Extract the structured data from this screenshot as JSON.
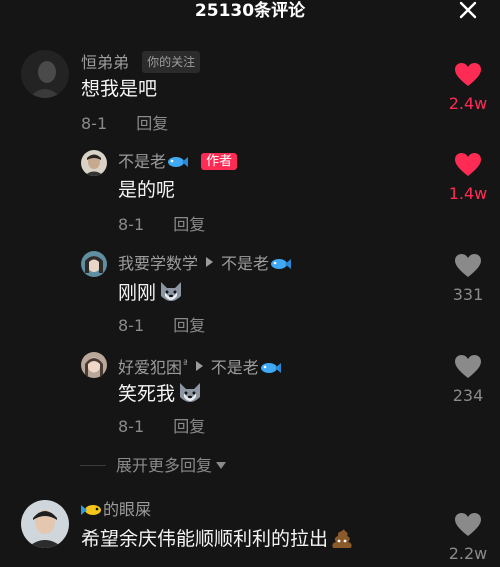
{
  "header": {
    "title": "25130条评论",
    "close_icon": "close-icon"
  },
  "comments": [
    {
      "author": "恒弟弟",
      "tag": "你的关注",
      "text": "想我是吧",
      "date": "8-1",
      "reply_label": "回复",
      "likes": "2.4w",
      "liked": true
    },
    {
      "author": "不是老",
      "tag": "作者",
      "text": "是的呢",
      "date": "8-1",
      "reply_label": "回复",
      "likes": "1.4w",
      "liked": true
    },
    {
      "author": "我要学数学",
      "reply_to": "不是老",
      "text": "刚刚",
      "date": "8-1",
      "reply_label": "回复",
      "likes": "331",
      "liked": false
    },
    {
      "author": "好爱犯困",
      "author_suffix": "ª",
      "reply_to": "不是老",
      "text": "笑死我",
      "date": "8-1",
      "reply_label": "回复",
      "likes": "234",
      "liked": false
    },
    {
      "author": "的眼屎",
      "text": "希望余庆伟能顺顺利利的拉出",
      "likes": "2.2w",
      "liked": false
    }
  ],
  "expand_replies": "展开更多回复",
  "colors": {
    "background": "#151515",
    "liked": "#fe2c55",
    "muted": "#8a8a8a"
  }
}
